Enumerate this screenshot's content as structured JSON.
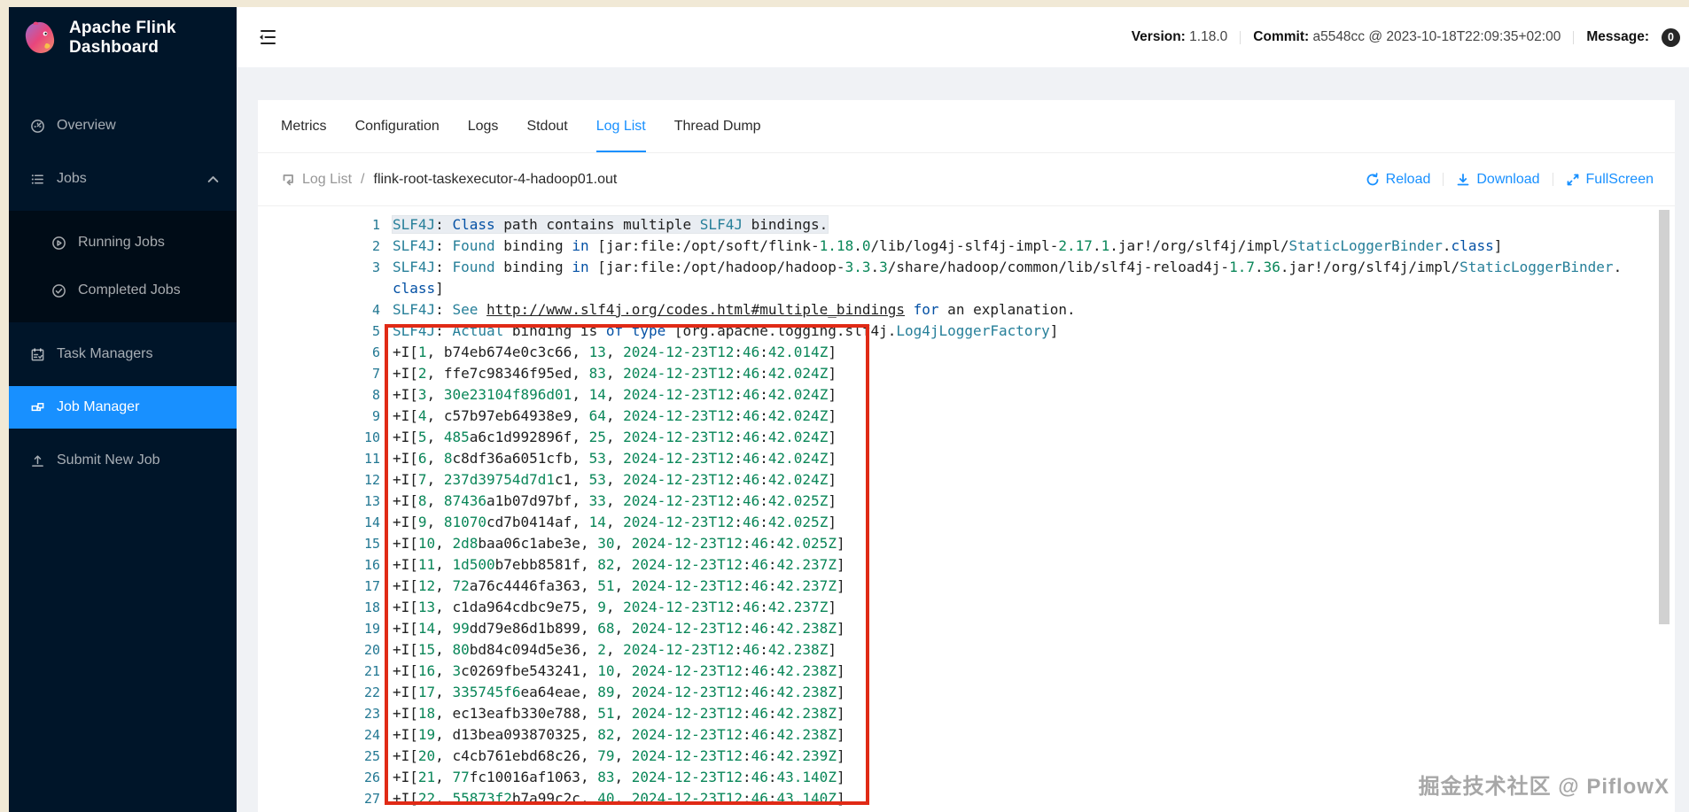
{
  "app": {
    "title": "Apache Flink Dashboard"
  },
  "colors": {
    "accent": "#1890ff",
    "sidebar_bg": "#001529",
    "submenu_bg": "#000c17",
    "annotation_red": "#e02a16",
    "badge_bg": "#262626",
    "line_number": "#237893"
  },
  "sidebar": {
    "items": [
      {
        "label": "Overview",
        "icon": "dashboard",
        "selected": false
      },
      {
        "label": "Jobs",
        "icon": "list",
        "selected": false,
        "expanded": true,
        "children": [
          {
            "label": "Running Jobs",
            "icon": "play-circle",
            "selected": false
          },
          {
            "label": "Completed Jobs",
            "icon": "check-circle",
            "selected": false
          }
        ]
      },
      {
        "label": "Task Managers",
        "icon": "schedule",
        "selected": false
      },
      {
        "label": "Job Manager",
        "icon": "cluster",
        "selected": true
      },
      {
        "label": "Submit New Job",
        "icon": "upload",
        "selected": false
      }
    ]
  },
  "header": {
    "version_label": "Version:",
    "version_value": "1.18.0",
    "commit_label": "Commit:",
    "commit_value": "a5548cc @ 2023-10-18T22:09:35+02:00",
    "message_label": "Message:",
    "message_count": "0"
  },
  "tabs": {
    "labels": [
      "Metrics",
      "Configuration",
      "Logs",
      "Stdout",
      "Log List",
      "Thread Dump"
    ],
    "active": "Log List"
  },
  "toolbar": {
    "breadcrumb_root": "Log List",
    "breadcrumb_file": "flink-root-taskexecutor-4-hadoop01.out",
    "reload_label": "Reload",
    "download_label": "Download",
    "fullscreen_label": "FullScreen"
  },
  "editor": {
    "syntax_colors": {
      "k": "#1f1f1f",
      "t": "#267f99",
      "b": "#0451a5",
      "g": "#098658",
      "u": "#1f1f1f"
    },
    "slf4j_lines": [
      {
        "num": 1,
        "highlight": true,
        "spans": [
          [
            "t",
            "SLF4J"
          ],
          [
            "k",
            ": "
          ],
          [
            "b",
            "Class"
          ],
          [
            "k",
            " path contains multiple "
          ],
          [
            "t",
            "SLF4J"
          ],
          [
            "k",
            " bindings."
          ]
        ]
      },
      {
        "num": 2,
        "spans": [
          [
            "t",
            "SLF4J"
          ],
          [
            "k",
            ": "
          ],
          [
            "t",
            "Found"
          ],
          [
            "k",
            " binding "
          ],
          [
            "b",
            "in"
          ],
          [
            "k",
            " [jar:file:/opt/soft/flink-"
          ],
          [
            "g",
            "1.18"
          ],
          [
            "k",
            "."
          ],
          [
            "g",
            "0"
          ],
          [
            "k",
            "/lib/log4j-slf4j-impl-"
          ],
          [
            "g",
            "2.17"
          ],
          [
            "k",
            "."
          ],
          [
            "g",
            "1"
          ],
          [
            "k",
            ".jar!/org/slf4j/impl/"
          ],
          [
            "t",
            "StaticLoggerBinder"
          ],
          [
            "k",
            "."
          ],
          [
            "b",
            "class"
          ],
          [
            "k",
            "]"
          ]
        ]
      },
      {
        "num": 3,
        "spans": [
          [
            "t",
            "SLF4J"
          ],
          [
            "k",
            ": "
          ],
          [
            "t",
            "Found"
          ],
          [
            "k",
            " binding "
          ],
          [
            "b",
            "in"
          ],
          [
            "k",
            " [jar:file:/opt/hadoop/hadoop-"
          ],
          [
            "g",
            "3.3"
          ],
          [
            "k",
            "."
          ],
          [
            "g",
            "3"
          ],
          [
            "k",
            "/share/hadoop/common/lib/slf4j-reload4j-"
          ],
          [
            "g",
            "1.7"
          ],
          [
            "k",
            "."
          ],
          [
            "g",
            "36"
          ],
          [
            "k",
            ".jar!/org/slf4j/impl/"
          ],
          [
            "t",
            "StaticLoggerBinder"
          ],
          [
            "k",
            "."
          ],
          [
            "b",
            "class"
          ],
          [
            "k",
            "]"
          ]
        ]
      },
      {
        "num": 4,
        "spans": [
          [
            "t",
            "SLF4J"
          ],
          [
            "k",
            ": "
          ],
          [
            "t",
            "See"
          ],
          [
            "k",
            " "
          ],
          [
            "u",
            "http://www.slf4j.org/codes.html#multiple_bindings"
          ],
          [
            "k",
            " "
          ],
          [
            "b",
            "for"
          ],
          [
            "k",
            " an explanation."
          ]
        ]
      },
      {
        "num": 5,
        "spans": [
          [
            "t",
            "SLF4J"
          ],
          [
            "k",
            ": "
          ],
          [
            "t",
            "Actual"
          ],
          [
            "k",
            " binding is "
          ],
          [
            "b",
            "of"
          ],
          [
            "k",
            " "
          ],
          [
            "b",
            "type"
          ],
          [
            "k",
            " [org.apache.logging.slf4j."
          ],
          [
            "t",
            "Log4jLoggerFactory"
          ],
          [
            "k",
            "]"
          ]
        ]
      }
    ],
    "insert_rows_start_line": 6,
    "insert_rows": [
      {
        "id": "1",
        "hash": "b74eb674e0c3c66",
        "value": "13",
        "time": "2024-12-23T12:46:42.014Z"
      },
      {
        "id": "2",
        "hash": "ffe7c98346f95ed",
        "value": "83",
        "time": "2024-12-23T12:46:42.024Z"
      },
      {
        "id": "3",
        "hash": "30e23104f896d01",
        "value": "14",
        "time": "2024-12-23T12:46:42.024Z"
      },
      {
        "id": "4",
        "hash": "c57b97eb64938e9",
        "value": "64",
        "time": "2024-12-23T12:46:42.024Z"
      },
      {
        "id": "5",
        "hash": "485a6c1d992896f",
        "value": "25",
        "time": "2024-12-23T12:46:42.024Z"
      },
      {
        "id": "6",
        "hash": "8c8df36a6051cfb",
        "value": "53",
        "time": "2024-12-23T12:46:42.024Z"
      },
      {
        "id": "7",
        "hash": "237d39754d7d1c1",
        "value": "53",
        "time": "2024-12-23T12:46:42.024Z"
      },
      {
        "id": "8",
        "hash": "87436a1b07d97bf",
        "value": "33",
        "time": "2024-12-23T12:46:42.025Z"
      },
      {
        "id": "9",
        "hash": "81070cd7b0414af",
        "value": "14",
        "time": "2024-12-23T12:46:42.025Z"
      },
      {
        "id": "10",
        "hash": "2d8baa06c1abe3e",
        "value": "30",
        "time": "2024-12-23T12:46:42.025Z"
      },
      {
        "id": "11",
        "hash": "1d500b7ebb8581f",
        "value": "82",
        "time": "2024-12-23T12:46:42.237Z"
      },
      {
        "id": "12",
        "hash": "72a76c4446fa363",
        "value": "51",
        "time": "2024-12-23T12:46:42.237Z"
      },
      {
        "id": "13",
        "hash": "c1da964cdbc9e75",
        "value": "9",
        "time": "2024-12-23T12:46:42.237Z"
      },
      {
        "id": "14",
        "hash": "99dd79e86d1b899",
        "value": "68",
        "time": "2024-12-23T12:46:42.238Z"
      },
      {
        "id": "15",
        "hash": "80bd84c094d5e36",
        "value": "2",
        "time": "2024-12-23T12:46:42.238Z"
      },
      {
        "id": "16",
        "hash": "3c0269fbe543241",
        "value": "10",
        "time": "2024-12-23T12:46:42.238Z"
      },
      {
        "id": "17",
        "hash": "335745f6ea64eae",
        "value": "89",
        "time": "2024-12-23T12:46:42.238Z"
      },
      {
        "id": "18",
        "hash": "ec13eafb330e788",
        "value": "51",
        "time": "2024-12-23T12:46:42.238Z"
      },
      {
        "id": "19",
        "hash": "d13bea093870325",
        "value": "82",
        "time": "2024-12-23T12:46:42.238Z"
      },
      {
        "id": "20",
        "hash": "c4cb761ebd68c26",
        "value": "79",
        "time": "2024-12-23T12:46:42.239Z"
      },
      {
        "id": "21",
        "hash": "77fc10016af1063",
        "value": "83",
        "time": "2024-12-23T12:46:43.140Z"
      },
      {
        "id": "22",
        "hash": "55873f2b7a99c2c",
        "value": "40",
        "time": "2024-12-23T12:46:43.140Z"
      }
    ]
  },
  "watermark": "掘金技术社区 @ PiflowX"
}
